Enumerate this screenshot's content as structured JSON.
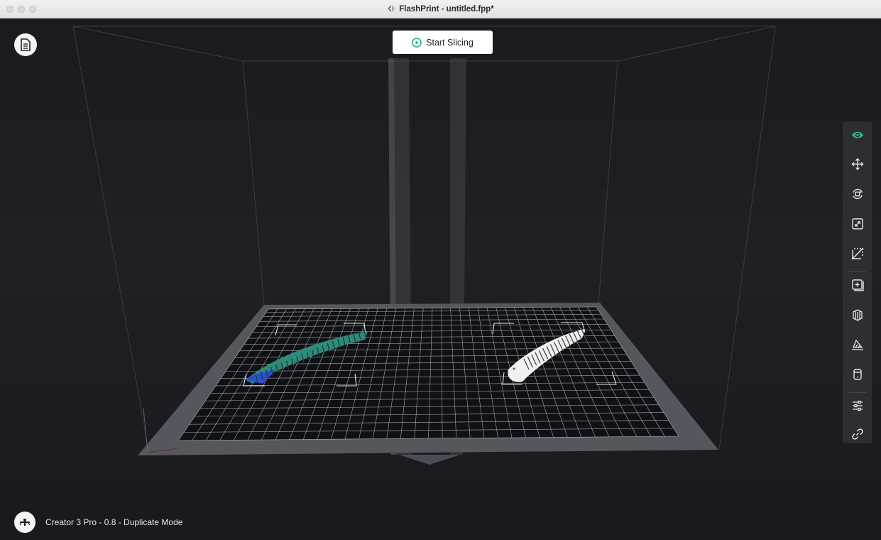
{
  "window": {
    "title": "FlashPrint - untitled.fpp*"
  },
  "toolbar_top": {
    "start_slicing_label": "Start Slicing"
  },
  "right_toolbar": {
    "items": [
      {
        "icon": "eye-icon",
        "active": true
      },
      {
        "icon": "move-icon"
      },
      {
        "icon": "rotate-icon"
      },
      {
        "icon": "scale-icon"
      },
      {
        "icon": "cut-icon"
      },
      {
        "icon": "add-model-icon"
      },
      {
        "icon": "supports-icon"
      },
      {
        "icon": "lay-flat-icon"
      },
      {
        "icon": "cylinder-icon"
      },
      {
        "icon": "settings-sliders-icon"
      },
      {
        "icon": "link-icon"
      }
    ]
  },
  "status_bar": {
    "printer_label": "Creator 3 Pro - 0.8 - Duplicate Mode"
  },
  "colors": {
    "accent": "#2bb37f",
    "background": "#1b1b1f",
    "build_plate": "#5a5c63",
    "grid": "#ffffff"
  }
}
